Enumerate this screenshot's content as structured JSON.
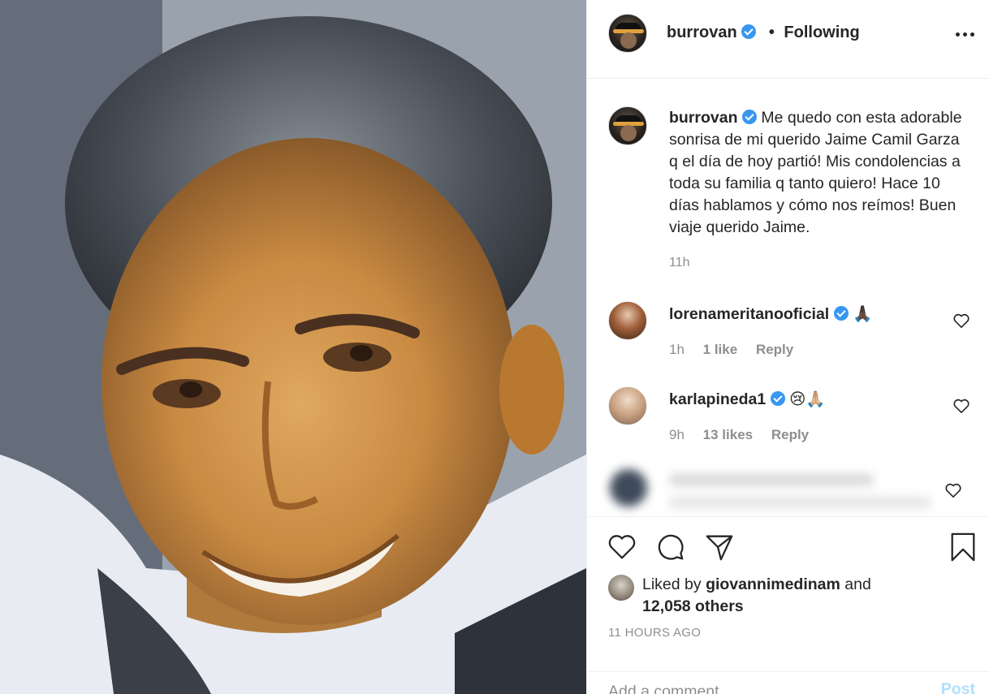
{
  "post": {
    "author": "burrovan",
    "follow_status": "Following",
    "separator": "•"
  },
  "caption": {
    "author": "burrovan",
    "text": "Me quedo con esta adorable sonrisa de mi querido Jaime Camil Garza q el día de hoy partió! Mis condolencias a toda su familia q tanto quiero! Hace 10 días hablamos y cómo nos reímos! Buen viaje querido Jaime.",
    "time": "11h"
  },
  "comments": [
    {
      "username": "lorenameritanooficial",
      "text": "🙏🏿",
      "time": "1h",
      "likes": "1 like",
      "reply": "Reply"
    },
    {
      "username": "karlapineda1",
      "text": "😢🙏🏼",
      "time": "9h",
      "likes": "13 likes",
      "reply": "Reply"
    }
  ],
  "likes": {
    "prefix": "Liked by",
    "liker": "giovannimedinam",
    "joiner": "and",
    "others": "12,058 others"
  },
  "timestamp": "11 HOURS AGO",
  "add_comment": {
    "placeholder": "Add a comment...",
    "post_label": "Post"
  },
  "icons": {
    "more": "more-options-icon",
    "verified": "verified-badge-icon",
    "like": "heart-icon",
    "comment": "comment-icon",
    "share": "share-icon",
    "save": "bookmark-icon"
  },
  "colors": {
    "verified": "#3897f0",
    "muted": "#8e8e8e",
    "post_disabled": "#b2dffc"
  }
}
